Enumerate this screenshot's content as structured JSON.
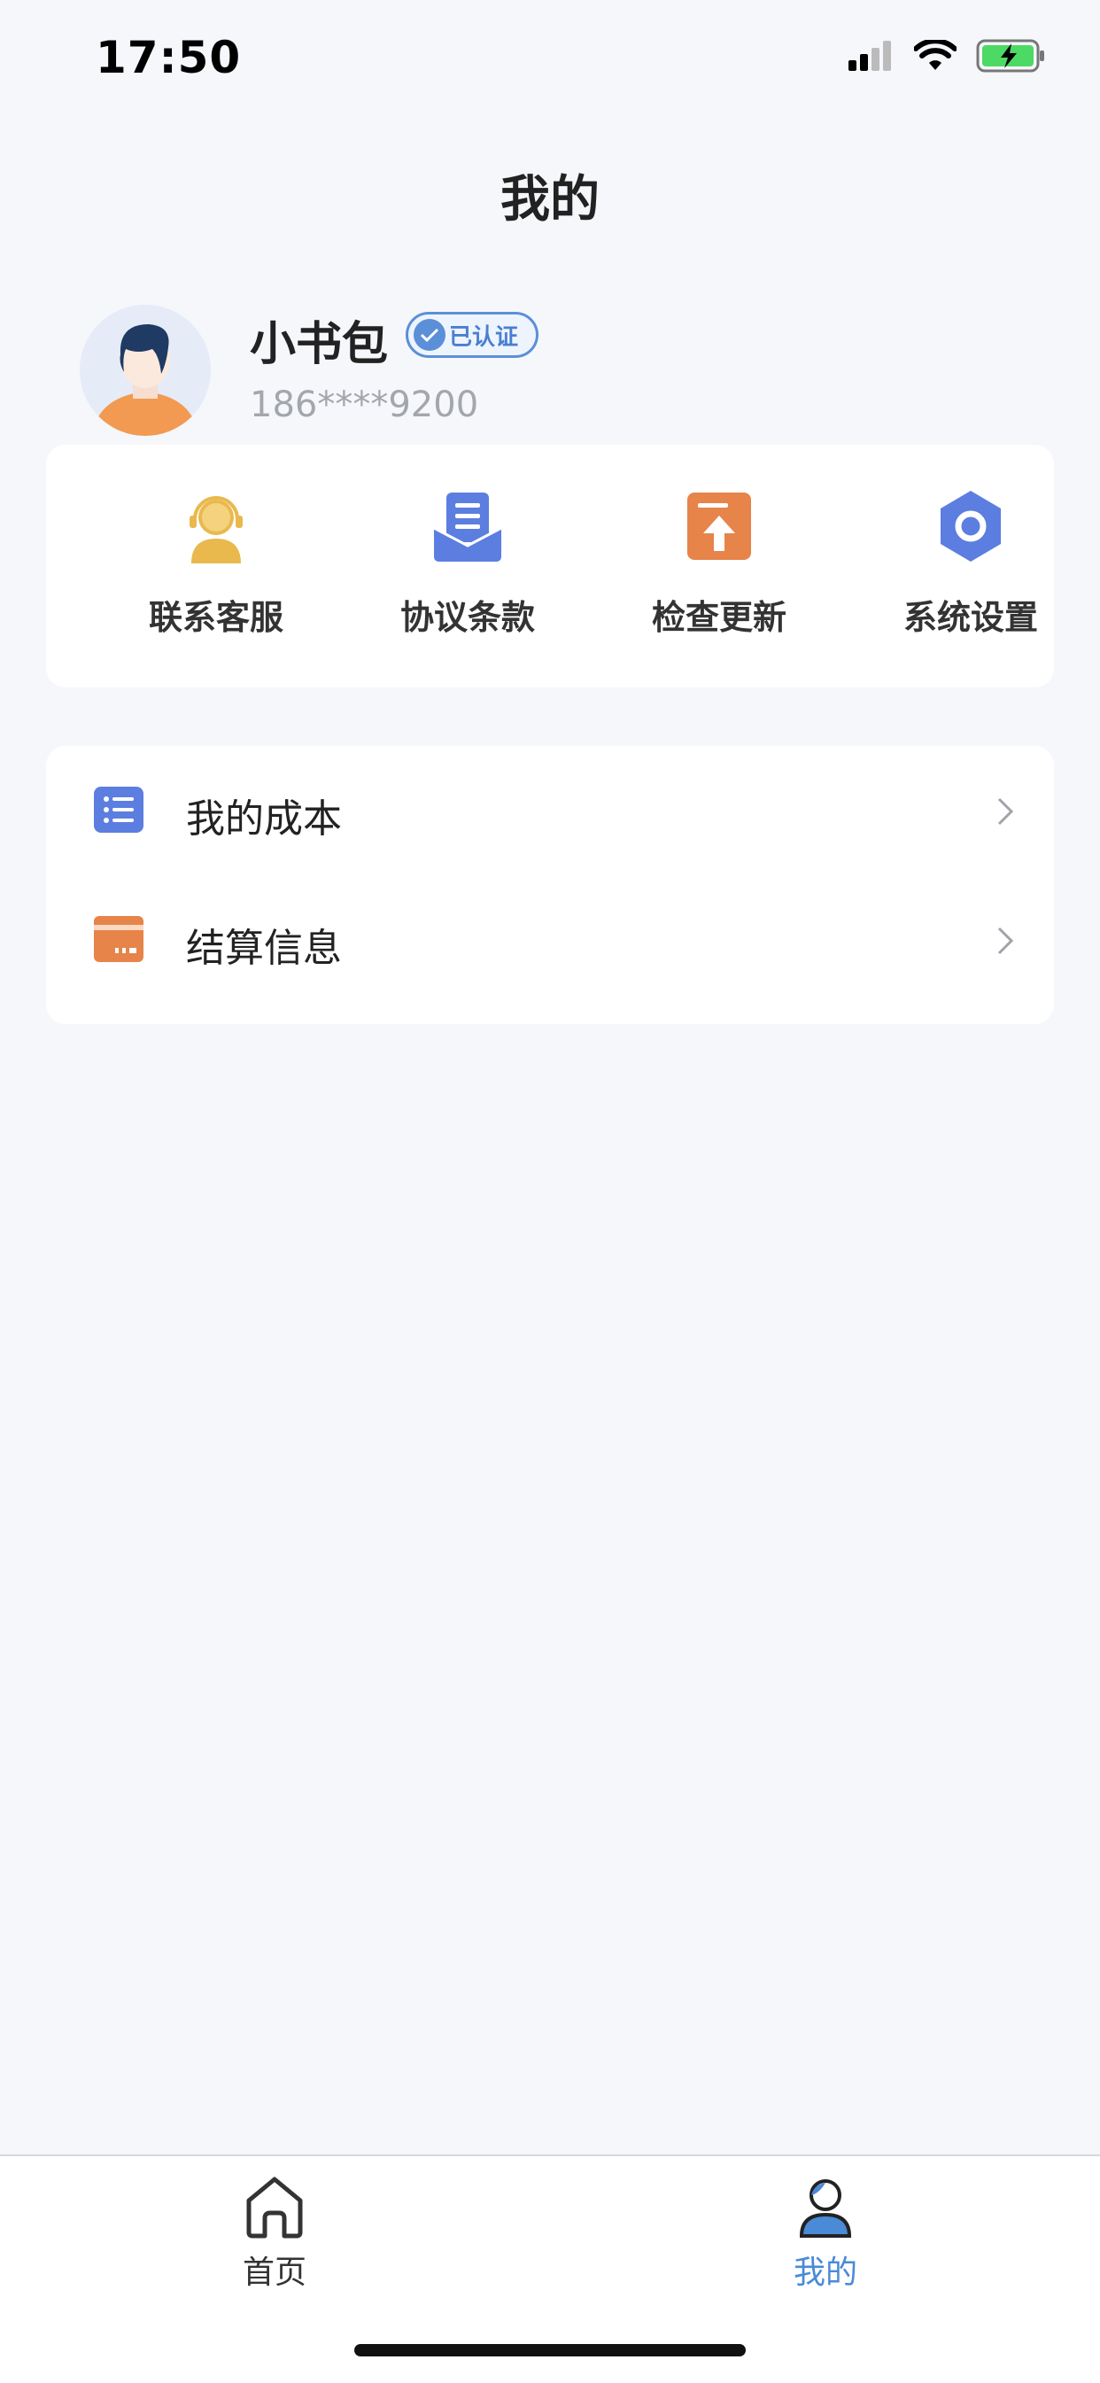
{
  "status_bar": {
    "time": "17:50"
  },
  "page": {
    "title": "我的"
  },
  "profile": {
    "name": "小书包",
    "verified_label": "已认证",
    "phone": "186****9200"
  },
  "quick_actions": [
    {
      "label": "联系客服",
      "icon": "customer-service-icon",
      "color": "#e9b94e"
    },
    {
      "label": "协议条款",
      "icon": "agreement-icon",
      "color": "#5b7ee0"
    },
    {
      "label": "检查更新",
      "icon": "update-icon",
      "color": "#e6844a"
    },
    {
      "label": "系统设置",
      "icon": "settings-icon",
      "color": "#5b7ee0"
    }
  ],
  "menu_list": [
    {
      "label": "我的成本",
      "icon": "list-icon",
      "color": "#5b7ee0"
    },
    {
      "label": "结算信息",
      "icon": "card-icon",
      "color": "#e6844a"
    }
  ],
  "tab_bar": {
    "tabs": [
      {
        "label": "首页",
        "icon": "home-icon",
        "active": false
      },
      {
        "label": "我的",
        "icon": "user-icon",
        "active": true
      }
    ]
  },
  "colors": {
    "accent": "#4a8ad6",
    "background": "#f6f7fb"
  }
}
